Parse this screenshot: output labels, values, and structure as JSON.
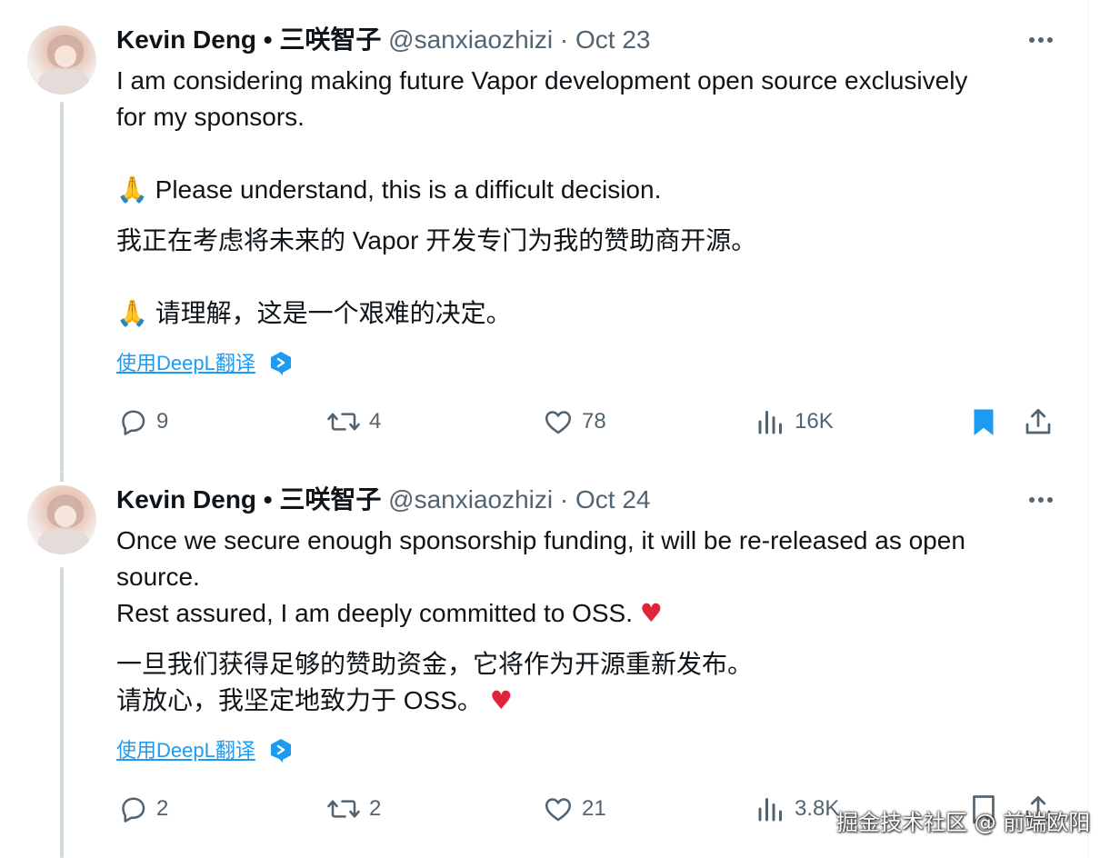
{
  "tweets": [
    {
      "author_name": "Kevin Deng • 三咲智子",
      "handle": "@sanxiaozhizi",
      "separator": "·",
      "date": "Oct 23",
      "lines": [
        "I am considering making future Vapor development open source exclusively",
        "for my sponsors.",
        "Please understand, this is a difficult decision.",
        "我正在考虑将未来的 Vapor 开发专门为我的赞助商开源。",
        "请理解，这是一个艰难的决定。"
      ],
      "translate_label": "使用DeepL翻译",
      "replies": "9",
      "retweets": "4",
      "likes": "78",
      "views": "16K",
      "bookmarked": true
    },
    {
      "author_name": "Kevin Deng • 三咲智子",
      "handle": "@sanxiaozhizi",
      "separator": "·",
      "date": "Oct 24",
      "lines": [
        "Once we secure enough sponsorship funding, it will be re-released as open",
        "source.",
        "Rest assured, I am deeply committed to OSS.",
        "一旦我们获得足够的赞助资金，它将作为开源重新发布。",
        "请放心，我坚定地致力于 OSS。"
      ],
      "translate_label": "使用DeepL翻译",
      "replies": "2",
      "retweets": "2",
      "likes": "21",
      "views": "3.8K",
      "bookmarked": false
    }
  ],
  "emoji": {
    "pray": "🙏",
    "heart": "♥"
  },
  "watermark": "掘金技术社区 @ 前端欧阳",
  "colors": {
    "text": "#0f1419",
    "secondary": "#536471",
    "link": "#1d9bf0",
    "bookmark": "#1d9bf0",
    "heart": "#e0243a",
    "thread_line": "#cfd9de"
  }
}
